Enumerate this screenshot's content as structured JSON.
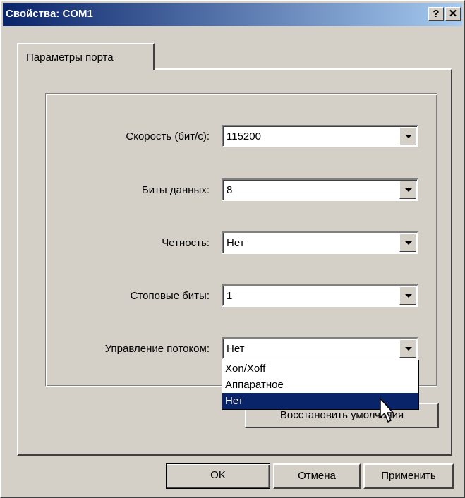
{
  "window": {
    "title": "Свойства: COM1",
    "help_label": "?",
    "close_label": "✕"
  },
  "tab": {
    "label": "Параметры порта"
  },
  "fields": [
    {
      "label": "Скорость (бит/с):",
      "value": "115200"
    },
    {
      "label": "Биты данных:",
      "value": "8"
    },
    {
      "label": "Четность:",
      "value": "Нет"
    },
    {
      "label": "Стоповые биты:",
      "value": "1"
    },
    {
      "label": "Управление потоком:",
      "value": "Нет"
    }
  ],
  "flow_dropdown": {
    "options": [
      "Xon/Xoff",
      "Аппаратное",
      "Нет"
    ],
    "selected": "Нет"
  },
  "restore_button": {
    "label": "Восстановить умолчания"
  },
  "footer": {
    "ok": "OK",
    "cancel": "Отмена",
    "apply": "Применить"
  }
}
